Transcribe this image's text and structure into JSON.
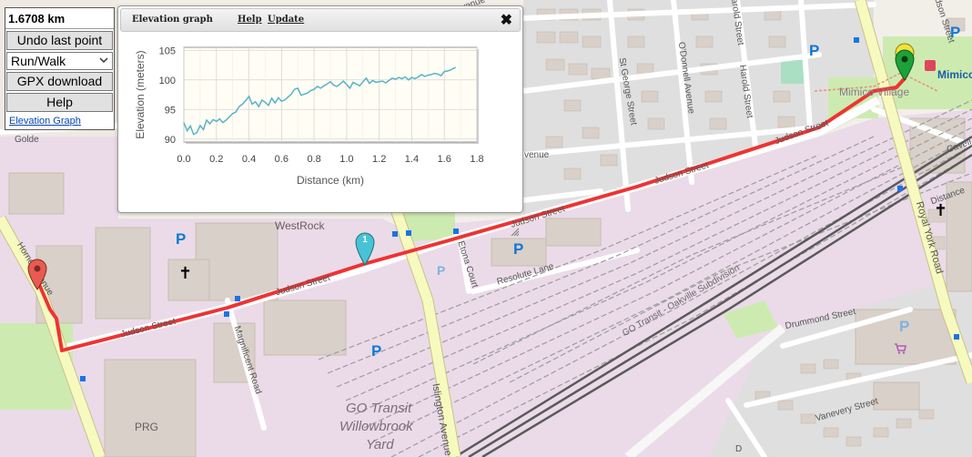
{
  "panel": {
    "distance": "1.6708 km",
    "undo_label": "Undo last point",
    "mode_value": "Run/Walk",
    "gpx_label": "GPX download",
    "help_label": "Help",
    "elev_link": "Elevation Graph"
  },
  "elevation_dialog": {
    "title": "Elevation graph",
    "help_link": "Help",
    "update_link": "Update",
    "close_glyph": "✖"
  },
  "chart_data": {
    "type": "line",
    "xlabel": "Distance (km)",
    "ylabel": "Elevation (meters)",
    "xlim": [
      0,
      1.8
    ],
    "ylim": [
      89.5,
      105.5
    ],
    "x_ticks": [
      "0.0",
      "0.2",
      "0.4",
      "0.6",
      "0.8",
      "1.0",
      "1.2",
      "1.4",
      "1.6",
      "1.8"
    ],
    "y_ticks": [
      "90",
      "95",
      "100",
      "105"
    ],
    "x_tick_values": [
      0,
      0.2,
      0.4,
      0.6,
      0.8,
      1.0,
      1.2,
      1.4,
      1.6,
      1.8
    ],
    "y_tick_values": [
      90,
      95,
      100,
      105
    ],
    "grid": true,
    "line_color": "#57b3c8",
    "series": [
      {
        "x": [
          0,
          0.02,
          0.04,
          0.06,
          0.08,
          0.1,
          0.12,
          0.14,
          0.16,
          0.18,
          0.2,
          0.22,
          0.24,
          0.26,
          0.28,
          0.3,
          0.32,
          0.34,
          0.36,
          0.38,
          0.4,
          0.42,
          0.44,
          0.46,
          0.48,
          0.5,
          0.52,
          0.54,
          0.56,
          0.58,
          0.6,
          0.62,
          0.64,
          0.66,
          0.68,
          0.7,
          0.72,
          0.74,
          0.76,
          0.78,
          0.8,
          0.82,
          0.84,
          0.86,
          0.88,
          0.9,
          0.92,
          0.94,
          0.96,
          0.98,
          1.0,
          1.02,
          1.04,
          1.06,
          1.08,
          1.1,
          1.12,
          1.14,
          1.16,
          1.18,
          1.2,
          1.22,
          1.24,
          1.26,
          1.28,
          1.3,
          1.32,
          1.34,
          1.36,
          1.38,
          1.4,
          1.42,
          1.44,
          1.46,
          1.48,
          1.5,
          1.52,
          1.54,
          1.56,
          1.58,
          1.6,
          1.62,
          1.64,
          1.66,
          1.67
        ],
        "values": [
          92.8,
          91.4,
          92.2,
          90.8,
          91.1,
          92.3,
          91.6,
          93.2,
          92.6,
          93.3,
          93.0,
          93.4,
          92.8,
          93.2,
          93.8,
          94.3,
          94.6,
          95.5,
          95.9,
          96.5,
          97.2,
          95.9,
          96.3,
          95.5,
          96.6,
          96.2,
          95.7,
          96.9,
          96.1,
          97.0,
          96.4,
          96.6,
          97.1,
          97.6,
          98.4,
          98.6,
          97.4,
          97.6,
          97.8,
          98.2,
          98.4,
          98.9,
          98.6,
          99.0,
          99.3,
          99.7,
          99.1,
          98.9,
          99.3,
          99.8,
          99.2,
          98.6,
          99.6,
          99.3,
          99.0,
          99.7,
          100.3,
          99.4,
          99.9,
          99.6,
          99.7,
          99.8,
          99.5,
          99.9,
          100.3,
          100.1,
          100.4,
          100.2,
          100.5,
          100.0,
          100.4,
          100.2,
          100.5,
          100.9,
          100.6,
          100.8,
          100.9,
          101.1,
          101.0,
          100.7,
          101.4,
          101.5,
          101.7,
          102.0,
          102.1
        ]
      }
    ]
  },
  "map": {
    "labels": {
      "westrock": "WestRock",
      "prg": "PRG",
      "go_yard_1": "GO Transit",
      "go_yard_2": "Willowbrook",
      "go_yard_3": "Yard",
      "judson_1": "Judson Street",
      "judson_2": "Judson Street",
      "judson_3": "Judson Street",
      "judson_4": "Judson Street",
      "judson_5": "Judson Street",
      "judson_top": "Judson Street",
      "resolute": "Resolute Lane",
      "etona": "Etona Court",
      "islington": "Islington Avenue",
      "magnificent": "Magnificent Road",
      "horner": "Horner Avenue",
      "royal_york": "Royal York Road",
      "drummond": "Drummond Street",
      "vanevery": "Vanevery Street",
      "oakville": "GO Transit - Oakville Subdivision",
      "mimico_village": "Mimico Village",
      "mimico": "Mimico",
      "st_george": "St George Street",
      "odonnell": "O'Donnell Avenue",
      "harold_1": "Harold Street",
      "harold_2": "Harold Street",
      "cavell": "Cavell",
      "distance_frag": "Distance",
      "golden_frag": "Golde",
      "avenue_frag": "venue",
      "avenue_frag2": "Avenue",
      "d_frag": "D"
    },
    "marker_label": "1",
    "parking": "P",
    "church": "✝"
  }
}
